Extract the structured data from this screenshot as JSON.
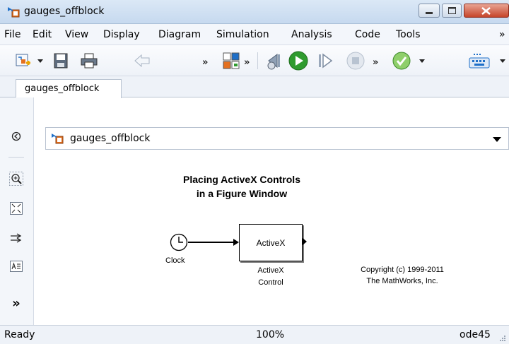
{
  "window": {
    "title": "gauges_offblock"
  },
  "menu": [
    "File",
    "Edit",
    "View",
    "Display",
    "Diagram",
    "Simulation",
    "Analysis",
    "Code",
    "Tools",
    "»"
  ],
  "toolbar": {
    "overflow": "»"
  },
  "tab": {
    "label": "gauges_offblock"
  },
  "address": {
    "path": "gauges_offblock"
  },
  "diagram": {
    "title_line1": "Placing ActiveX Controls",
    "title_line2": "in a Figure Window",
    "clock_label": "Clock",
    "activex_block_text": "ActiveX",
    "activex_label_line1": "ActiveX",
    "activex_label_line2": "Control",
    "copyright_line1": "Copyright (c) 1999-2011",
    "copyright_line2": "The MathWorks, Inc."
  },
  "leftbar": {
    "more": "»"
  },
  "status": {
    "ready": "Ready",
    "zoom": "100%",
    "solver": "ode45"
  },
  "colors": {
    "run_green": "#2f9b2f",
    "check_green": "#2f9b2f",
    "block_orange": "#e4701f",
    "window_close": "#c6452a"
  }
}
